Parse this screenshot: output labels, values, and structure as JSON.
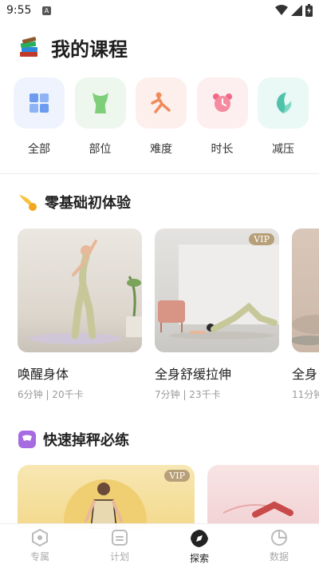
{
  "status": {
    "time": "9:55",
    "notification": "A"
  },
  "header": {
    "title": "我的课程",
    "icon": "books-icon"
  },
  "categories": [
    {
      "label": "全部",
      "icon": "grid-icon",
      "bg": "#eef3fd"
    },
    {
      "label": "部位",
      "icon": "body-icon",
      "bg": "#eef7ee"
    },
    {
      "label": "难度",
      "icon": "pose-icon",
      "bg": "#fdf0ec"
    },
    {
      "label": "时长",
      "icon": "alarm-clock-icon",
      "bg": "#fdeef0"
    },
    {
      "label": "减压",
      "icon": "leaf-icon",
      "bg": "#eaf8f6"
    }
  ],
  "sections": {
    "beginner": {
      "title": "零基础初体验",
      "courses": [
        {
          "name": "唤醒身体",
          "meta": "6分钟 | 20千卡",
          "vip": ""
        },
        {
          "name": "全身舒缓拉伸",
          "meta": "7分钟 | 23千卡",
          "vip": "VIP"
        },
        {
          "name": "全身",
          "meta": "11分钟",
          "vip": ""
        }
      ]
    },
    "fast": {
      "title": "快速掉秤必练",
      "promos": [
        {
          "vip": "VIP"
        },
        {
          "vip": ""
        }
      ]
    }
  },
  "tabs": [
    {
      "label": "专属",
      "icon": "exclusive-icon",
      "active": false
    },
    {
      "label": "计划",
      "icon": "plan-icon",
      "active": false
    },
    {
      "label": "探索",
      "icon": "compass-icon",
      "active": true
    },
    {
      "label": "数据",
      "icon": "pie-chart-icon",
      "active": false
    }
  ],
  "colors": {
    "vip_badge": "#b79f7a",
    "active_tab": "#222222",
    "inactive_tab": "#aaaaaa"
  }
}
